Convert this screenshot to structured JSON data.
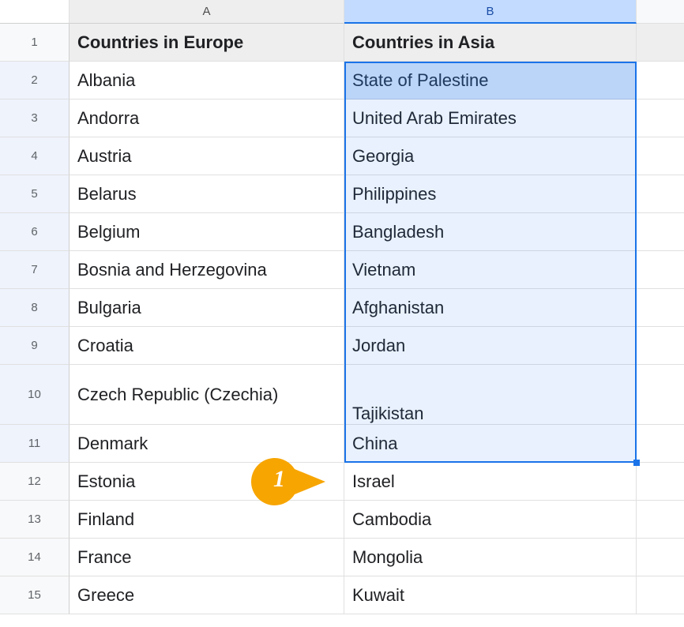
{
  "columns": {
    "A": "A",
    "B": "B",
    "C": ""
  },
  "headers": {
    "a": "Countries in Europe",
    "b": "Countries in Asia"
  },
  "rows": [
    {
      "n": "1",
      "a": "Countries in Europe",
      "b": "Countries in Asia",
      "header": true
    },
    {
      "n": "2",
      "a": "Albania",
      "b": "State of Palestine"
    },
    {
      "n": "3",
      "a": "Andorra",
      "b": "United Arab Emirates"
    },
    {
      "n": "4",
      "a": "Austria",
      "b": "Georgia"
    },
    {
      "n": "5",
      "a": "Belarus",
      "b": "Philippines"
    },
    {
      "n": "6",
      "a": "Belgium",
      "b": "Bangladesh"
    },
    {
      "n": "7",
      "a": "Bosnia and Herzegovina",
      "b": "Vietnam"
    },
    {
      "n": "8",
      "a": "Bulgaria",
      "b": "Afghanistan"
    },
    {
      "n": "9",
      "a": "Croatia",
      "b": "Jordan"
    },
    {
      "n": "10",
      "a": "Czech Republic (Czechia)",
      "b": "Tajikistan",
      "tall": true
    },
    {
      "n": "11",
      "a": "Denmark",
      "b": "China"
    },
    {
      "n": "12",
      "a": "Estonia",
      "b": "Israel"
    },
    {
      "n": "13",
      "a": "Finland",
      "b": "Cambodia"
    },
    {
      "n": "14",
      "a": "France",
      "b": "Mongolia"
    },
    {
      "n": "15",
      "a": "Greece",
      "b": "Kuwait"
    }
  ],
  "selection": {
    "active_cell": "B2",
    "range": "B2:B11"
  },
  "annotation": {
    "label": "1"
  }
}
